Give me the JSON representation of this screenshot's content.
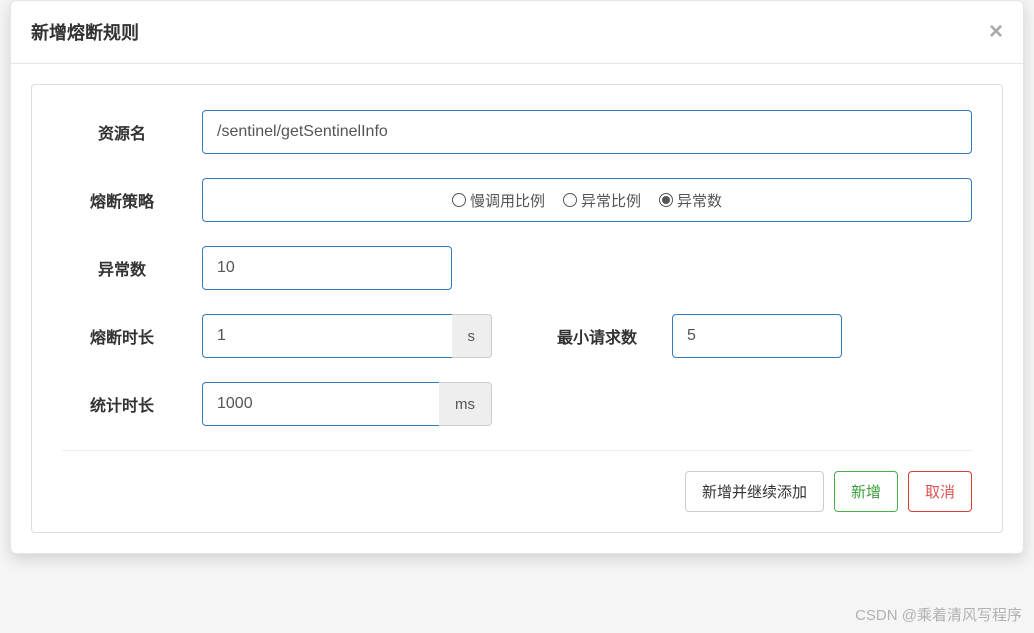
{
  "modal": {
    "title": "新增熔断规则"
  },
  "form": {
    "resource": {
      "label": "资源名",
      "value": "/sentinel/getSentinelInfo"
    },
    "strategy": {
      "label": "熔断策略",
      "options": [
        {
          "label": "慢调用比例",
          "checked": false
        },
        {
          "label": "异常比例",
          "checked": false
        },
        {
          "label": "异常数",
          "checked": true
        }
      ]
    },
    "exceptionCount": {
      "label": "异常数",
      "value": "10"
    },
    "breakDuration": {
      "label": "熔断时长",
      "value": "1",
      "unit": "s"
    },
    "minRequest": {
      "label": "最小请求数",
      "value": "5"
    },
    "statDuration": {
      "label": "统计时长",
      "value": "1000",
      "unit": "ms"
    }
  },
  "buttons": {
    "addContinue": "新增并继续添加",
    "add": "新增",
    "cancel": "取消"
  },
  "watermark": "CSDN @乘着清风写程序"
}
